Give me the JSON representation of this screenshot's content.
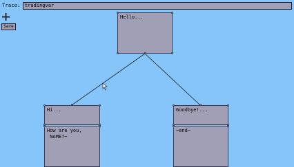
{
  "toolbar": {
    "trace_label": "Trace:",
    "trace_value": "tradingvar",
    "save_label": "Save"
  },
  "nodes": {
    "root": {
      "text": "Hello..."
    },
    "left_prompt": {
      "text": "Hi..."
    },
    "left_response": {
      "text": "How are you,\n NAME?~"
    },
    "right_prompt": {
      "text": "Goodbye!..."
    },
    "right_response": {
      "text": "~end~"
    }
  },
  "icons": {
    "add": "plus-icon",
    "cursor": "mouse-cursor-icon"
  }
}
